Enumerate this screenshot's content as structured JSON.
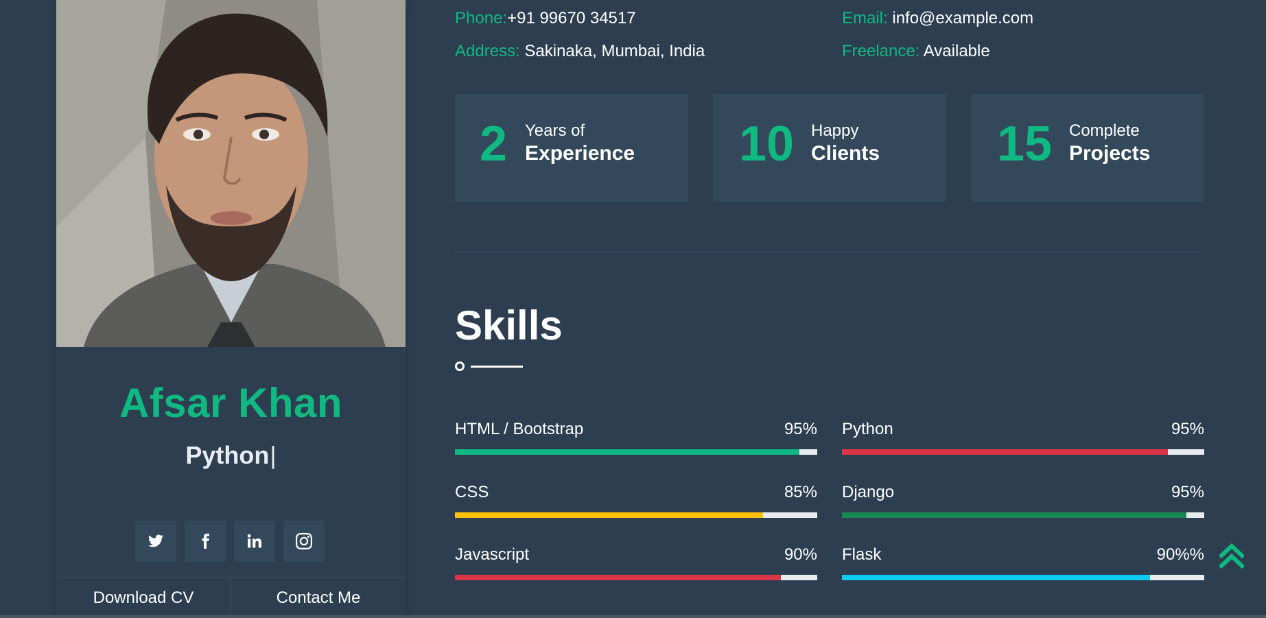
{
  "profile": {
    "name": "Afsar Khan",
    "typed_text": "Python",
    "cursor": "|",
    "actions": {
      "download_cv": "Download CV",
      "contact_me": "Contact Me"
    },
    "socials": [
      "twitter-icon",
      "facebook-icon",
      "linkedin-icon",
      "instagram-icon"
    ]
  },
  "info": {
    "phone_label": "Phone:",
    "phone_value": "+91 99670 34517",
    "email_label": "Email:",
    "email_value": " info@example.com",
    "address_label": "Address:",
    "address_value": " Sakinaka, Mumbai, India",
    "freelance_label": "Freelance:",
    "freelance_value": " Available"
  },
  "stats": [
    {
      "number": "2",
      "top": "Years of",
      "bottom": "Experience"
    },
    {
      "number": "10",
      "top": "Happy",
      "bottom": "Clients"
    },
    {
      "number": "15",
      "top": "Complete",
      "bottom": "Projects"
    }
  ],
  "skills_section": {
    "title": "Skills",
    "items": [
      {
        "name": "HTML / Bootstrap",
        "percent_label": "95%",
        "percent": 95,
        "color": "#10b981"
      },
      {
        "name": "Python",
        "percent_label": "95%",
        "percent": 90,
        "color": "#dc3545"
      },
      {
        "name": "CSS",
        "percent_label": "85%",
        "percent": 85,
        "color": "#ffc107"
      },
      {
        "name": "Django",
        "percent_label": "95%",
        "percent": 95,
        "color": "#198754"
      },
      {
        "name": "Javascript",
        "percent_label": "90%",
        "percent": 90,
        "color": "#dc3545"
      },
      {
        "name": "Flask",
        "percent_label": "90%%",
        "percent": 85,
        "color": "#0dcaf0"
      }
    ]
  },
  "colors": {
    "background": "#2c3e50",
    "card": "#34485b",
    "accent": "#10b981"
  },
  "back_to_top_icon": "double-chevron-up-icon"
}
